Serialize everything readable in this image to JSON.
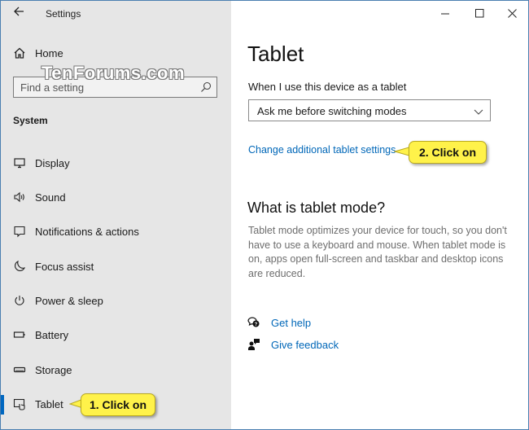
{
  "window": {
    "title": "Settings",
    "back_icon": "back-arrow-icon",
    "controls": {
      "minimize": "minimize-icon",
      "maximize": "maximize-icon",
      "close": "close-icon"
    },
    "border_color": "#4a7fb0"
  },
  "sidebar": {
    "home_label": "Home",
    "watermark": "TenForums.com",
    "search": {
      "placeholder": "Find a setting",
      "value": ""
    },
    "section_title": "System",
    "items": [
      {
        "label": "Display",
        "icon": "display-icon"
      },
      {
        "label": "Sound",
        "icon": "speaker-icon"
      },
      {
        "label": "Notifications & actions",
        "icon": "notification-icon"
      },
      {
        "label": "Focus assist",
        "icon": "moon-icon"
      },
      {
        "label": "Power & sleep",
        "icon": "power-icon"
      },
      {
        "label": "Battery",
        "icon": "battery-icon"
      },
      {
        "label": "Storage",
        "icon": "storage-icon"
      },
      {
        "label": "Tablet",
        "icon": "tablet-icon",
        "selected": true
      }
    ],
    "background": "#e6e6e6",
    "accent": "#0067c0"
  },
  "main": {
    "title": "Tablet",
    "tablet_mode_label": "When I use this device as a tablet",
    "tablet_mode_select": {
      "value": "Ask me before switching modes"
    },
    "additional_settings_link": "Change additional tablet settings",
    "what_is_heading": "What is tablet mode?",
    "what_is_description": "Tablet mode optimizes your device for touch, so you don't have to use a keyboard and mouse. When tablet mode is on, apps open full-screen and taskbar and desktop icons are reduced.",
    "get_help": "Get help",
    "give_feedback": "Give feedback",
    "link_color": "#0067b8"
  },
  "callouts": [
    {
      "text": "1. Click on",
      "color": "#fff24a"
    },
    {
      "text": "2. Click on",
      "color": "#fff24a"
    }
  ]
}
